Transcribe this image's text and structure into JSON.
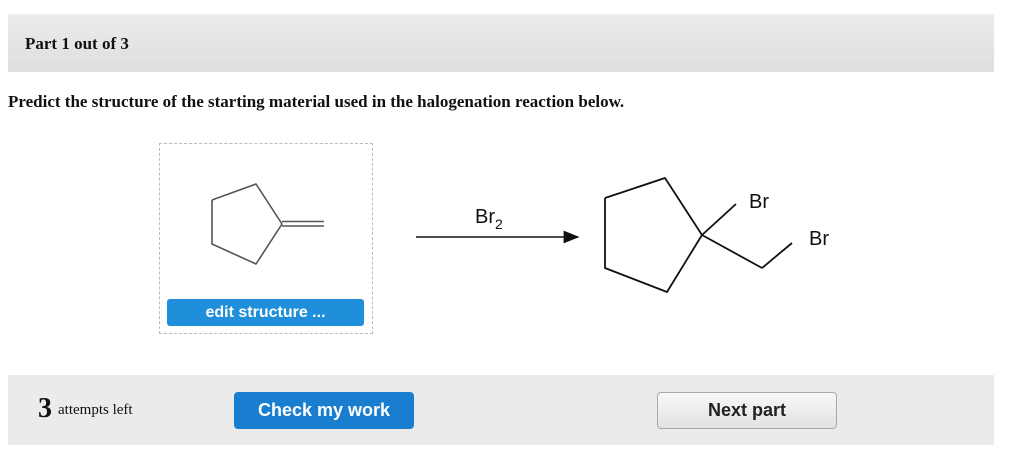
{
  "header": {
    "part_title": "Part 1 out of 3"
  },
  "question": {
    "text": "Predict the structure of the starting material used in the halogenation reaction below."
  },
  "starting_material": {
    "edit_label": "edit structure ..."
  },
  "reaction": {
    "reagent": "Br",
    "reagent_subscript": "2",
    "product_labels": [
      "Br",
      "Br"
    ]
  },
  "footer": {
    "attempts_count": "3",
    "attempts_text": "attempts left",
    "check_label": "Check my work",
    "next_label": "Next part"
  }
}
